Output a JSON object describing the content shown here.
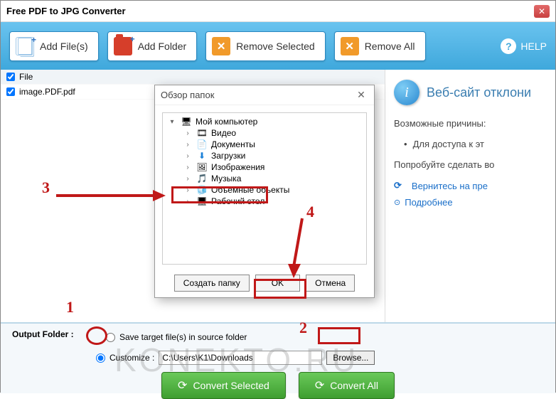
{
  "window": {
    "title": "Free PDF to JPG Converter"
  },
  "toolbar": {
    "addFiles": "Add File(s)",
    "addFolder": "Add Folder",
    "removeSelected": "Remove Selected",
    "removeAll": "Remove All",
    "help": "HELP"
  },
  "fileList": {
    "headerLabel": "File",
    "items": [
      {
        "name": "image.PDF.pdf",
        "checked": true
      }
    ]
  },
  "sidePanel": {
    "title": "Веб-сайт отклони",
    "reasonsHeading": "Возможные причины:",
    "reason1": "Для доступа к эт",
    "tryHeading": "Попробуйте сделать во",
    "backLink": "Вернитесь на пре",
    "moreLink": "Подробнее"
  },
  "output": {
    "label": "Output Folder :",
    "saveSourceLabel": "Save target file(s) in source folder",
    "customizeLabel": "Customize :",
    "path": "C:\\Users\\K1\\Downloads",
    "browse": "Browse..."
  },
  "convert": {
    "selected": "Convert Selected",
    "all": "Convert All"
  },
  "dialog": {
    "title": "Обзор папок",
    "tree": {
      "root": "Мой компьютер",
      "items": [
        {
          "label": "Видео",
          "icon": "ic-video"
        },
        {
          "label": "Документы",
          "icon": "ic-docs"
        },
        {
          "label": "Загрузки",
          "icon": "ic-down"
        },
        {
          "label": "Изображения",
          "icon": "ic-img"
        },
        {
          "label": "Музыка",
          "icon": "ic-music"
        },
        {
          "label": "Объемные объекты",
          "icon": "ic-obj"
        },
        {
          "label": "Рабочий стол",
          "icon": "ic-desk"
        }
      ]
    },
    "newFolder": "Создать папку",
    "ok": "OK",
    "cancel": "Отмена"
  },
  "annotations": {
    "n1": "1",
    "n2": "2",
    "n3": "3",
    "n4": "4"
  },
  "watermark": "KONEKTO.RU"
}
